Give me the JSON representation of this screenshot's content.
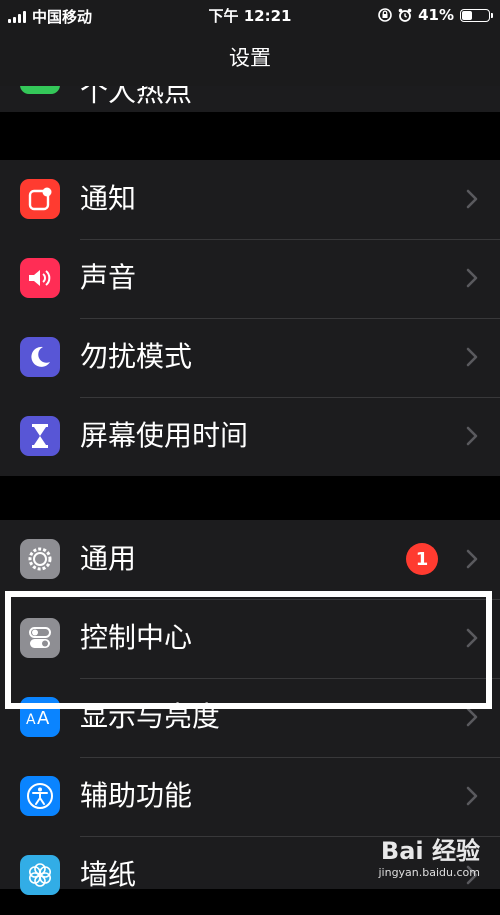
{
  "status_bar": {
    "carrier": "中国移动",
    "time": "下午 12:21",
    "battery": "41%",
    "battery_level": 0.41
  },
  "nav": {
    "title": "设置"
  },
  "peek_row": {
    "label": "个人热点"
  },
  "group1": [
    {
      "label": "通知",
      "icon": "notifications-icon",
      "color": "#ff3b30"
    },
    {
      "label": "声音",
      "icon": "speaker-icon",
      "color": "#ff2d55"
    },
    {
      "label": "勿扰模式",
      "icon": "moon-icon",
      "color": "#5856d6"
    },
    {
      "label": "屏幕使用时间",
      "icon": "hourglass-icon",
      "color": "#5856d6"
    }
  ],
  "group2": [
    {
      "label": "通用",
      "icon": "gear-icon",
      "color": "#8e8e93",
      "badge": "1"
    },
    {
      "label": "控制中心",
      "icon": "toggles-icon",
      "color": "#8e8e93"
    },
    {
      "label": "显示与亮度",
      "icon": "text-size-icon",
      "color": "#0a84ff"
    },
    {
      "label": "辅助功能",
      "icon": "accessibility-icon",
      "color": "#0a84ff"
    },
    {
      "label": "墙纸",
      "icon": "flower-icon",
      "color": "#32ade6"
    }
  ],
  "watermark": {
    "main": "Bai 经验",
    "sub": "jingyan.baidu.com"
  }
}
